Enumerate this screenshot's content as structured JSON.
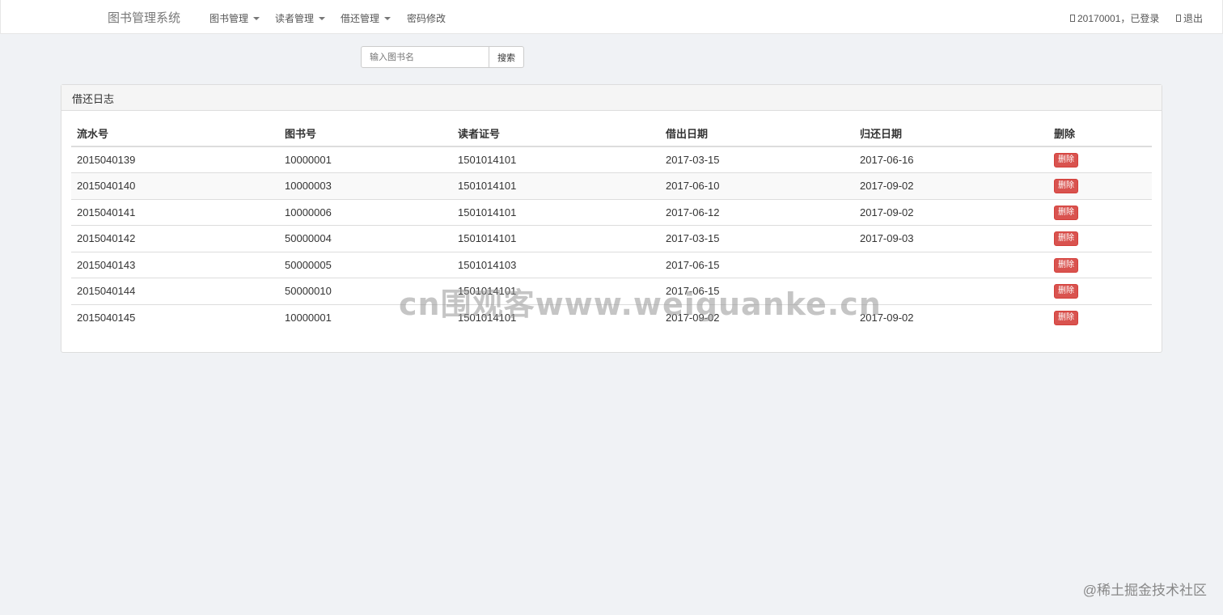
{
  "navbar": {
    "brand": "图书管理系统",
    "items": [
      {
        "label": "图书管理",
        "has_caret": true
      },
      {
        "label": "读者管理",
        "has_caret": true
      },
      {
        "label": "借还管理",
        "has_caret": true
      },
      {
        "label": "密码修改",
        "has_caret": false
      }
    ],
    "user_status": "20170001，已登录",
    "logout": "退出"
  },
  "search": {
    "placeholder": "输入图书名",
    "button": "搜索"
  },
  "panel": {
    "title": "借还日志",
    "columns": [
      "流水号",
      "图书号",
      "读者证号",
      "借出日期",
      "归还日期",
      "删除"
    ],
    "rows": [
      {
        "serial": "2015040139",
        "book": "10000001",
        "reader": "1501014101",
        "lend": "2017-03-15",
        "return": "2017-06-16",
        "action": "删除"
      },
      {
        "serial": "2015040140",
        "book": "10000003",
        "reader": "1501014101",
        "lend": "2017-06-10",
        "return": "2017-09-02",
        "action": "删除"
      },
      {
        "serial": "2015040141",
        "book": "10000006",
        "reader": "1501014101",
        "lend": "2017-06-12",
        "return": "2017-09-02",
        "action": "删除"
      },
      {
        "serial": "2015040142",
        "book": "50000004",
        "reader": "1501014101",
        "lend": "2017-03-15",
        "return": "2017-09-03",
        "action": "删除"
      },
      {
        "serial": "2015040143",
        "book": "50000005",
        "reader": "1501014103",
        "lend": "2017-06-15",
        "return": "",
        "action": "删除"
      },
      {
        "serial": "2015040144",
        "book": "50000010",
        "reader": "1501014101",
        "lend": "2017-06-15",
        "return": "",
        "action": "删除"
      },
      {
        "serial": "2015040145",
        "book": "10000001",
        "reader": "1501014101",
        "lend": "2017-09-02",
        "return": "2017-09-02",
        "action": "删除"
      }
    ]
  },
  "watermark": "cn围观客www.weiguanke.cn",
  "corner_mark": "@稀土掘金技术社区",
  "colors": {
    "danger": "#d9534f",
    "background": "#f0f2f5"
  }
}
